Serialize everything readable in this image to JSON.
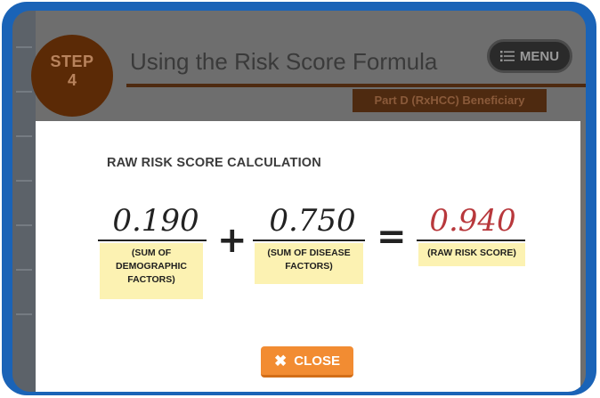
{
  "header": {
    "step_word": "STEP",
    "step_number": "4",
    "title": "Using the Risk Score Formula",
    "subtitle_badge": "Part D (RxHCC) Beneficiary",
    "menu_label": "MENU",
    "menu_icon": "list-icon"
  },
  "modal": {
    "title": "RAW RISK SCORE CALCULATION",
    "terms": [
      {
        "value": "0.190",
        "label_lines": [
          "(SUM OF",
          "DEMOGRAPHIC",
          "FACTORS)"
        ]
      },
      {
        "value": "0.750",
        "label_lines": [
          "(SUM OF DISEASE",
          "FACTORS)"
        ]
      }
    ],
    "result": {
      "value": "0.940",
      "label_lines": [
        "(RAW RISK SCORE)"
      ]
    },
    "operators": {
      "plus": "+",
      "equals": "="
    },
    "close_label": "CLOSE",
    "close_icon": "x-icon"
  },
  "colors": {
    "frame_blue": "#1a63b7",
    "result_red": "#b8383c",
    "label_yellow": "#fcf2b2",
    "close_orange": "#f28c32"
  }
}
